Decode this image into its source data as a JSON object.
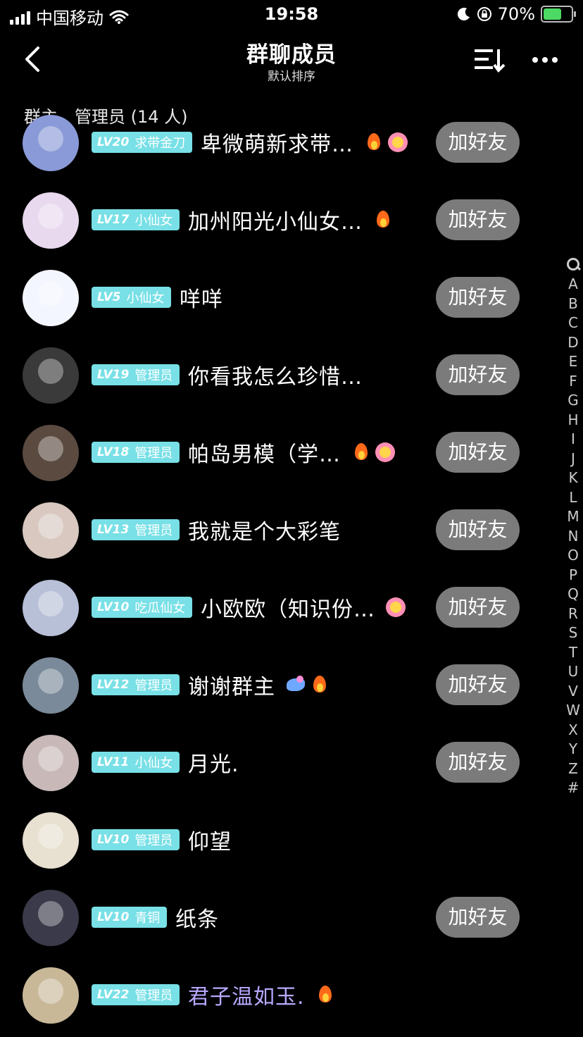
{
  "status_bar": {
    "carrier": "中国移动",
    "time": "19:58",
    "battery_percent": "70%",
    "battery_level": 0.7
  },
  "nav": {
    "title": "群聊成员",
    "subtitle": "默认排序"
  },
  "section": {
    "title": "群主、管理员 (14 人)"
  },
  "add_friend_label": "加好友",
  "members": [
    {
      "level": "LV20",
      "badge": "求带金刀",
      "name": "卑微萌新求带…",
      "emojis": [
        "fire",
        "flower"
      ],
      "add_friend": true,
      "avatar_color": "#8a9ad8"
    },
    {
      "level": "LV17",
      "badge": "小仙女",
      "name": "加州阳光小仙女…",
      "emojis": [
        "fire"
      ],
      "add_friend": true,
      "avatar_color": "#e9d9ee"
    },
    {
      "level": "LV5",
      "badge": "小仙女",
      "name": "咩咩",
      "emojis": [],
      "add_friend": true,
      "avatar_color": "#f4f6ff"
    },
    {
      "level": "LV19",
      "badge": "管理员",
      "name": "你看我怎么珍惜…",
      "emojis": [],
      "add_friend": true,
      "avatar_color": "#3a3a3a"
    },
    {
      "level": "LV18",
      "badge": "管理员",
      "name": "帕岛男模（学…",
      "emojis": [
        "fire",
        "flower"
      ],
      "add_friend": true,
      "avatar_color": "#5a4a40"
    },
    {
      "level": "LV13",
      "badge": "管理员",
      "name": "我就是个大彩笔",
      "emojis": [],
      "add_friend": true,
      "avatar_color": "#d8c8c0"
    },
    {
      "level": "LV10",
      "badge": "吃瓜仙女",
      "name": "小欧欧（知识份…",
      "emojis": [
        "flower"
      ],
      "add_friend": true,
      "avatar_color": "#b8c0d8"
    },
    {
      "level": "LV12",
      "badge": "管理员",
      "name": "谢谢群主",
      "emojis": [
        "dragon",
        "fire"
      ],
      "add_friend": true,
      "avatar_color": "#7a8a9a"
    },
    {
      "level": "LV11",
      "badge": "小仙女",
      "name": "月光.",
      "emojis": [],
      "add_friend": true,
      "avatar_color": "#c8b8b8"
    },
    {
      "level": "LV10",
      "badge": "管理员",
      "name": "仰望",
      "emojis": [],
      "add_friend": false,
      "avatar_color": "#e8e0d0"
    },
    {
      "level": "LV10",
      "badge": "青铜",
      "name": "纸条",
      "emojis": [],
      "add_friend": true,
      "avatar_color": "#3a3a4a"
    },
    {
      "level": "LV22",
      "badge": "管理员",
      "name": "君子温如玉.",
      "emojis": [
        "fire"
      ],
      "add_friend": false,
      "avatar_color": "#c8b898",
      "name_color": "#b9a8ff"
    }
  ],
  "index_bar": {
    "letters": [
      "A",
      "B",
      "C",
      "D",
      "E",
      "F",
      "G",
      "H",
      "I",
      "J",
      "K",
      "L",
      "M",
      "N",
      "O",
      "P",
      "Q",
      "R",
      "S",
      "T",
      "U",
      "V",
      "W",
      "X",
      "Y",
      "Z",
      "#"
    ]
  }
}
